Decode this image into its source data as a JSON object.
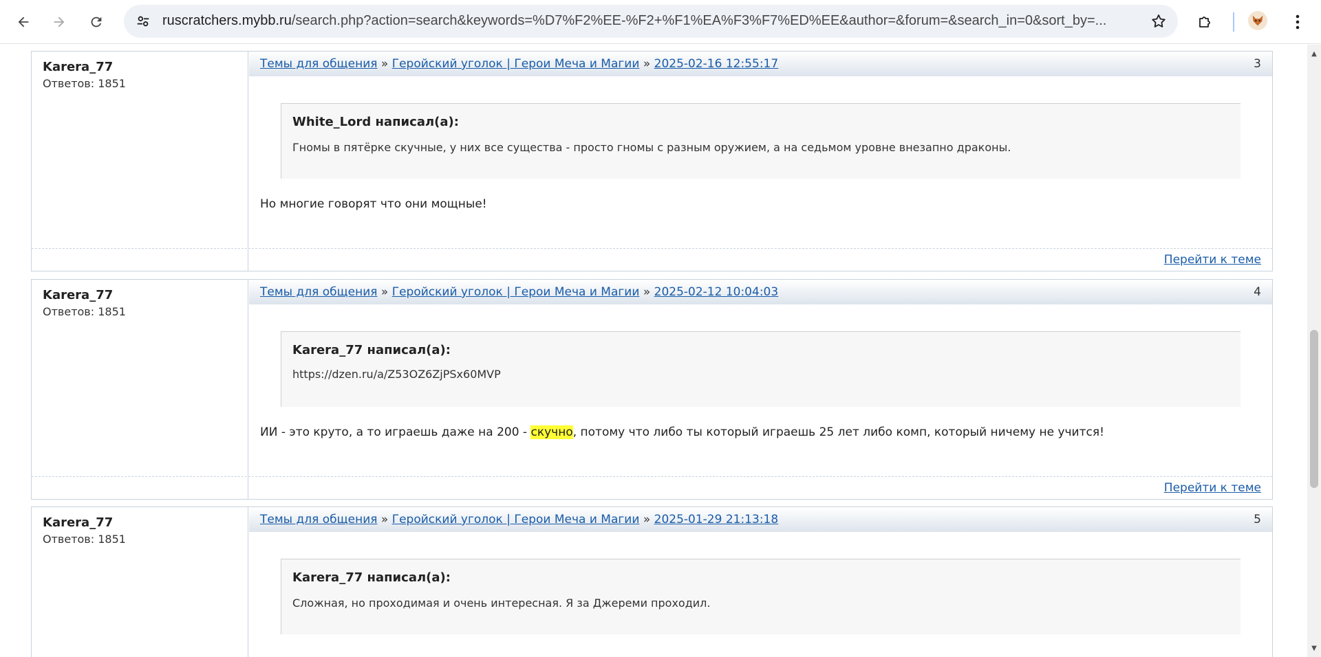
{
  "browser": {
    "url_host": "ruscratchers.mybb.ru",
    "url_rest": "/search.php?action=search&keywords=%D7%F2%EE-%F2+%F1%EA%F3%F7%ED%EE&author=&forum=&search_in=0&sort_by=..."
  },
  "posts": [
    {
      "author": "Karera_77",
      "replies": "Ответов: 1851",
      "crumb1": "Темы для общения",
      "sep": "»",
      "crumb2": "Геройский уголок | Герои Меча и Магии",
      "date": "2025-02-16 12:55:17",
      "num": "3",
      "quote_head": "White_Lord написал(а):",
      "quote_text": "Гномы в пятёрке скучные, у них все существа - просто гномы с разным оружием, а на седьмом уровне внезапно драконы.",
      "body_pre": "Но многие говорят что они мощные!",
      "body_hl": "",
      "body_post": "",
      "goto": "Перейти к теме"
    },
    {
      "author": "Karera_77",
      "replies": "Ответов: 1851",
      "crumb1": "Темы для общения",
      "sep": "»",
      "crumb2": "Геройский уголок | Герои Меча и Магии",
      "date": "2025-02-12 10:04:03",
      "num": "4",
      "quote_head": "Karera_77 написал(а):",
      "quote_text": "https://dzen.ru/a/Z53OZ6ZjPSx60MVP",
      "body_pre": "ИИ - это круто, а то играешь даже на 200 - ",
      "body_hl": "скучно",
      "body_post": ", потому что либо ты который играешь 25 лет либо комп, который ничему не учится!",
      "goto": "Перейти к теме"
    },
    {
      "author": "Karera_77",
      "replies": "Ответов: 1851",
      "crumb1": "Темы для общения",
      "sep": "»",
      "crumb2": "Геройский уголок | Герои Меча и Магии",
      "date": "2025-01-29 21:13:18",
      "num": "5",
      "quote_head": "Karera_77 написал(а):",
      "quote_text": "Сложная, но проходимая и очень интересная. Я за Джереми проходил."
    }
  ]
}
